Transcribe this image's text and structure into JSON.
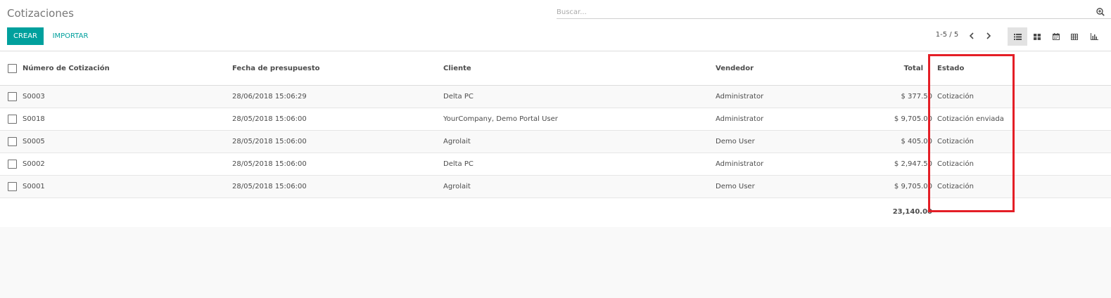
{
  "app": {
    "title": "Cotizaciones"
  },
  "search": {
    "placeholder": "Buscar...",
    "value": "",
    "icon": "search-plus-icon"
  },
  "buttons": {
    "create_label": "CREAR",
    "import_label": "IMPORTAR"
  },
  "pager": {
    "value": "1-5 / 5"
  },
  "view_switcher": [
    {
      "name": "list",
      "icon": "list-icon",
      "active": true
    },
    {
      "name": "kanban",
      "icon": "kanban-icon",
      "active": false
    },
    {
      "name": "calendar",
      "icon": "calendar-icon",
      "active": false
    },
    {
      "name": "pivot",
      "icon": "pivot-table-icon",
      "active": false
    },
    {
      "name": "graph",
      "icon": "bar-chart-icon",
      "active": false
    }
  ],
  "table": {
    "columns": [
      "Número de Cotización",
      "Fecha de presupuesto",
      "Cliente",
      "Vendedor",
      "Total",
      "Estado"
    ],
    "rows": [
      {
        "number": "S0003",
        "date": "28/06/2018 15:06:29",
        "customer": "Delta PC",
        "salesperson": "Administrator",
        "total": "$ 377.50",
        "status": "Cotización"
      },
      {
        "number": "S0018",
        "date": "28/05/2018 15:06:00",
        "customer": "YourCompany, Demo Portal User",
        "salesperson": "Administrator",
        "total": "$ 9,705.00",
        "status": "Cotización enviada"
      },
      {
        "number": "S0005",
        "date": "28/05/2018 15:06:00",
        "customer": "Agrolait",
        "salesperson": "Demo User",
        "total": "$ 405.00",
        "status": "Cotización"
      },
      {
        "number": "S0002",
        "date": "28/05/2018 15:06:00",
        "customer": "Delta PC",
        "salesperson": "Administrator",
        "total": "$ 2,947.50",
        "status": "Cotización"
      },
      {
        "number": "S0001",
        "date": "28/05/2018 15:06:00",
        "customer": "Agrolait",
        "salesperson": "Demo User",
        "total": "$ 9,705.00",
        "status": "Cotización"
      }
    ],
    "footer_total": "23,140.00"
  },
  "colors": {
    "accent": "#00a09d",
    "highlight": "#e41e26",
    "text": "#4c4c4c"
  }
}
